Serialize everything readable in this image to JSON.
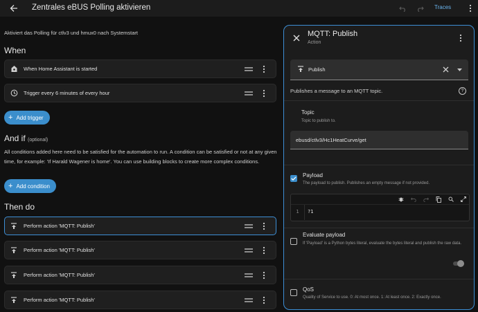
{
  "header": {
    "title": "Zentrales eBUS Polling aktivieren",
    "traces_label": "Traces"
  },
  "automation": {
    "description": "Aktiviert das Polling für ctlv3 und hmux0 nach Systemstart",
    "when_title": "When",
    "triggers": [
      {
        "label": "When Home Assistant is started",
        "icon": "home-assistant-icon"
      },
      {
        "label": "Trigger every 6 minutes of every hour",
        "icon": "clock-icon"
      }
    ],
    "add_trigger_label": "Add trigger",
    "and_if_title": "And if",
    "and_if_note": "(optional)",
    "conditions_text": "All conditions added here need to be satisfied for the automation to run. A condition can be satisfied or not at any given time, for example: 'If Harald Wagener is home'. You can use building blocks to create more complex conditions.",
    "add_condition_label": "Add condition",
    "then_do_title": "Then do",
    "actions": [
      {
        "label": "Perform action 'MQTT: Publish'",
        "icon": "publish-icon"
      },
      {
        "label": "Perform action 'MQTT: Publish'",
        "icon": "publish-icon"
      },
      {
        "label": "Perform action 'MQTT: Publish'",
        "icon": "publish-icon"
      },
      {
        "label": "Perform action 'MQTT: Publish'",
        "icon": "publish-icon"
      }
    ]
  },
  "panel": {
    "title": "MQTT: Publish",
    "subtitle": "Action",
    "action_value": "Publish",
    "description": "Publishes a message to an MQTT topic.",
    "help_glyph": "?",
    "topic": {
      "label": "Topic",
      "description": "Topic to publish to.",
      "value": "ebusd/ctlv3/Hc1HeatCurve/get"
    },
    "payload": {
      "label": "Payload",
      "description": "The payload to publish. Publishes an empty message if not provided.",
      "checked": true,
      "line_number": "1",
      "code": "?1"
    },
    "evaluate_payload": {
      "label": "Evaluate payload",
      "description": "If 'Payload' is a Python bytes literal, evaluate the bytes literal and publish the raw data.",
      "checked": false,
      "toggle_on": false
    },
    "qos": {
      "label": "QoS",
      "description": "Quality of Service to use. 0: At most once. 1: At least once. 2: Exactly once.",
      "checked": false
    }
  },
  "colors": {
    "accent": "#3b8ecc",
    "selected_border": "#3d8fd6",
    "link": "#6ab4ee"
  }
}
